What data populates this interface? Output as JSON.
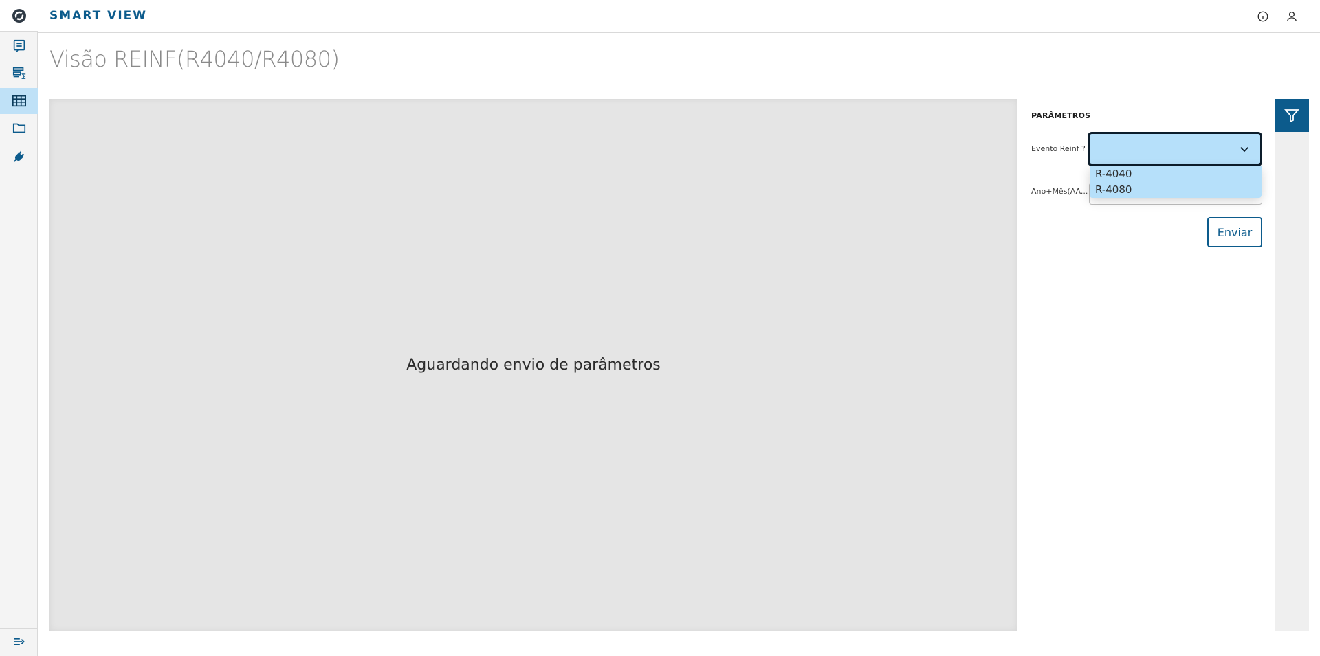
{
  "app": {
    "title": "SMART VIEW"
  },
  "sidebar": {
    "items": [
      {
        "icon": "report-icon",
        "active": false
      },
      {
        "icon": "summary-table-icon",
        "active": false
      },
      {
        "icon": "grid-table-icon",
        "active": true
      },
      {
        "icon": "folder-icon",
        "active": false
      },
      {
        "icon": "plug-icon",
        "active": false
      }
    ],
    "collapse_icon": "expand-menu-icon"
  },
  "header": {
    "icons": [
      "info-icon",
      "user-icon"
    ]
  },
  "page": {
    "title": "Visão REINF(R4040/R4080)"
  },
  "main": {
    "message": "Aguardando envio de parâmetros"
  },
  "params": {
    "title": "PARÂMETROS",
    "fields": [
      {
        "label": "Evento Reinf ?",
        "value": "",
        "options": [
          "R-4040",
          "R-4080"
        ]
      },
      {
        "label": "Ano+Mês(AA...",
        "value": ""
      }
    ],
    "submit_label": "Enviar"
  },
  "filter": {
    "icon": "filter-icon"
  },
  "colors": {
    "accent": "#0c5b8c",
    "active_bg": "#bfe1f7",
    "select_bg": "#b6e0fa",
    "main_bg": "#e5e5e5"
  }
}
